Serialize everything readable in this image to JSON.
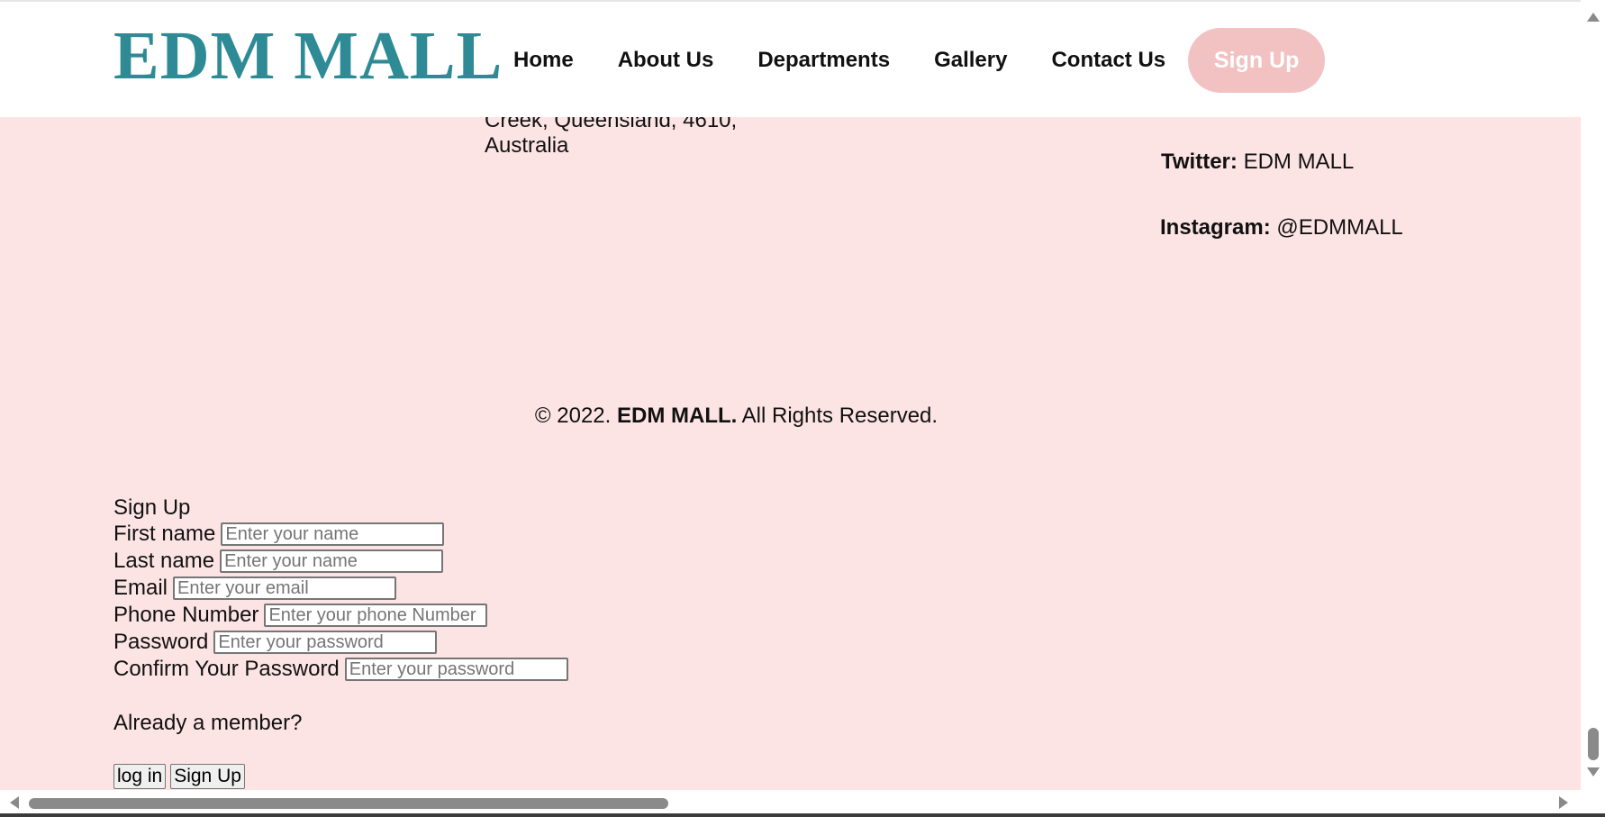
{
  "header": {
    "logo": "EDM MALL",
    "nav": [
      {
        "label": "Home"
      },
      {
        "label": "About Us"
      },
      {
        "label": "Departments"
      },
      {
        "label": "Gallery"
      },
      {
        "label": "Contact Us"
      }
    ],
    "signup_label": "Sign Up"
  },
  "footer": {
    "address_line1": "Creek, Queensland, 4610,",
    "address_line2": "Australia",
    "twitter_label": "Twitter:",
    "twitter_value": "EDM MALL",
    "instagram_label": "Instagram:",
    "instagram_value": "@EDMMALL",
    "copyright_prefix": "© 2022.",
    "copyright_brand": "EDM MALL.",
    "copyright_suffix": "All Rights Reserved."
  },
  "signup_form": {
    "title": "Sign Up",
    "fields": [
      {
        "label": "First name",
        "placeholder": "Enter your name",
        "value": ""
      },
      {
        "label": "Last name",
        "placeholder": "Enter your name",
        "value": ""
      },
      {
        "label": "Email",
        "placeholder": "Enter your email",
        "value": ""
      },
      {
        "label": "Phone Number",
        "placeholder": "Enter your phone Number",
        "value": ""
      },
      {
        "label": "Password",
        "placeholder": "Enter your password",
        "value": ""
      },
      {
        "label": "Confirm Your Password",
        "placeholder": "Enter your password",
        "value": ""
      }
    ],
    "member_prompt": "Already a member?",
    "login_button": "log in",
    "signup_button": "Sign Up"
  },
  "colors": {
    "logo": "#2e8b96",
    "page_background": "#fde4e4",
    "signup_pill": "#f2c1c1"
  }
}
